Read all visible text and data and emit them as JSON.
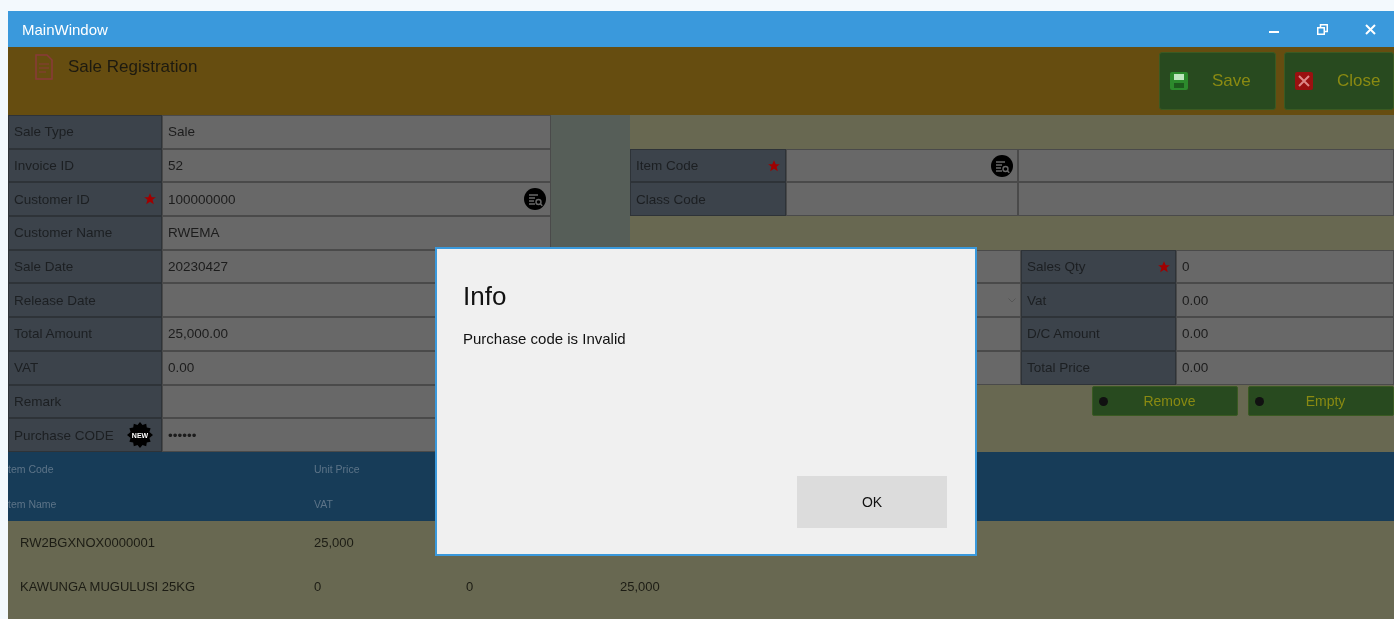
{
  "window": {
    "title": "MainWindow"
  },
  "header": {
    "title": "Sale Registration",
    "buttons": [
      {
        "label": "Save",
        "kind": "save"
      },
      {
        "label": "Close",
        "kind": "close"
      }
    ]
  },
  "form_left": [
    {
      "label": "Sale Type",
      "value": "Sale",
      "required": false,
      "lookup": false
    },
    {
      "label": "Invoice ID",
      "value": "52",
      "required": false,
      "lookup": false
    },
    {
      "label": "Customer ID",
      "value": "100000000",
      "required": true,
      "lookup": true
    },
    {
      "label": "Customer Name",
      "value": "RWEMA",
      "required": false,
      "lookup": false
    },
    {
      "label": "Sale Date",
      "value": "20230427",
      "required": false,
      "lookup": false
    },
    {
      "label": "Release Date",
      "required": false,
      "lookup": false
    },
    {
      "label": "Total Amount",
      "value": "25,000.00",
      "required": false,
      "lookup": false
    },
    {
      "label": "VAT",
      "value": "0.00",
      "required": false,
      "lookup": false
    },
    {
      "label": "Remark",
      "required": false,
      "lookup": false
    },
    {
      "label": "Purchase CODE",
      "badge": "NEW",
      "value": "••••••",
      "required": false,
      "lookup": false
    }
  ],
  "item_fields": [
    {
      "label": "Item Code",
      "required": true,
      "lookup": true
    },
    {
      "label": "Class Code",
      "required": false,
      "lookup": false
    }
  ],
  "amount_fields": [
    {
      "label": "Sales Qty",
      "value": "0",
      "required": true
    },
    {
      "label": "Vat",
      "value": "0.00",
      "required": false
    },
    {
      "label": "D/C Amount",
      "value": "0.00",
      "required": false
    },
    {
      "label": "Total Price",
      "value": "0.00",
      "required": false
    }
  ],
  "item_buttons": [
    "Remove",
    "Empty"
  ],
  "table": {
    "header_rows": [
      [
        "tem Code",
        "Unit Price"
      ],
      [
        "tem Name",
        "VAT"
      ]
    ],
    "rows": [
      [
        "RW2BGXNOX0000001",
        "25,000"
      ],
      [
        "KAWUNGA MUGULUSI 25KG",
        "0",
        "0",
        "25,000"
      ]
    ]
  },
  "dialog": {
    "title": "Info",
    "message": "Purchase code is Invalid",
    "button": "OK"
  }
}
